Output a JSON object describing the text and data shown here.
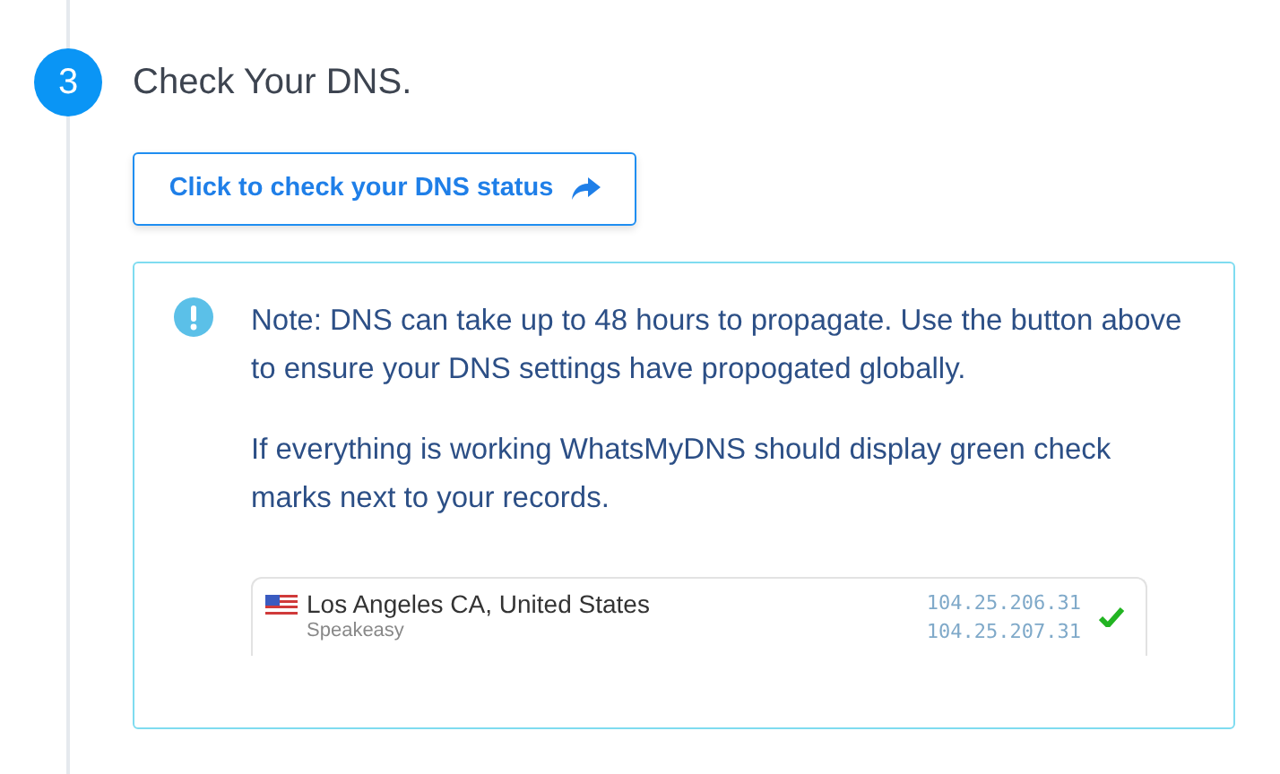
{
  "step": {
    "number": "3",
    "title": "Check Your DNS."
  },
  "button": {
    "label": "Click to check your DNS status"
  },
  "notice": {
    "paragraphs": [
      "Note: DNS can take up to 48 hours to propagate. Use the button above to ensure your DNS settings have propogated globally.",
      "If everything is working WhatsMyDNS should display green check marks next to your records."
    ],
    "example": {
      "location": "Los Angeles CA, United States",
      "provider": "Speakeasy",
      "addresses": [
        "104.25.206.31",
        "104.25.207.31"
      ],
      "ok": true
    }
  }
}
